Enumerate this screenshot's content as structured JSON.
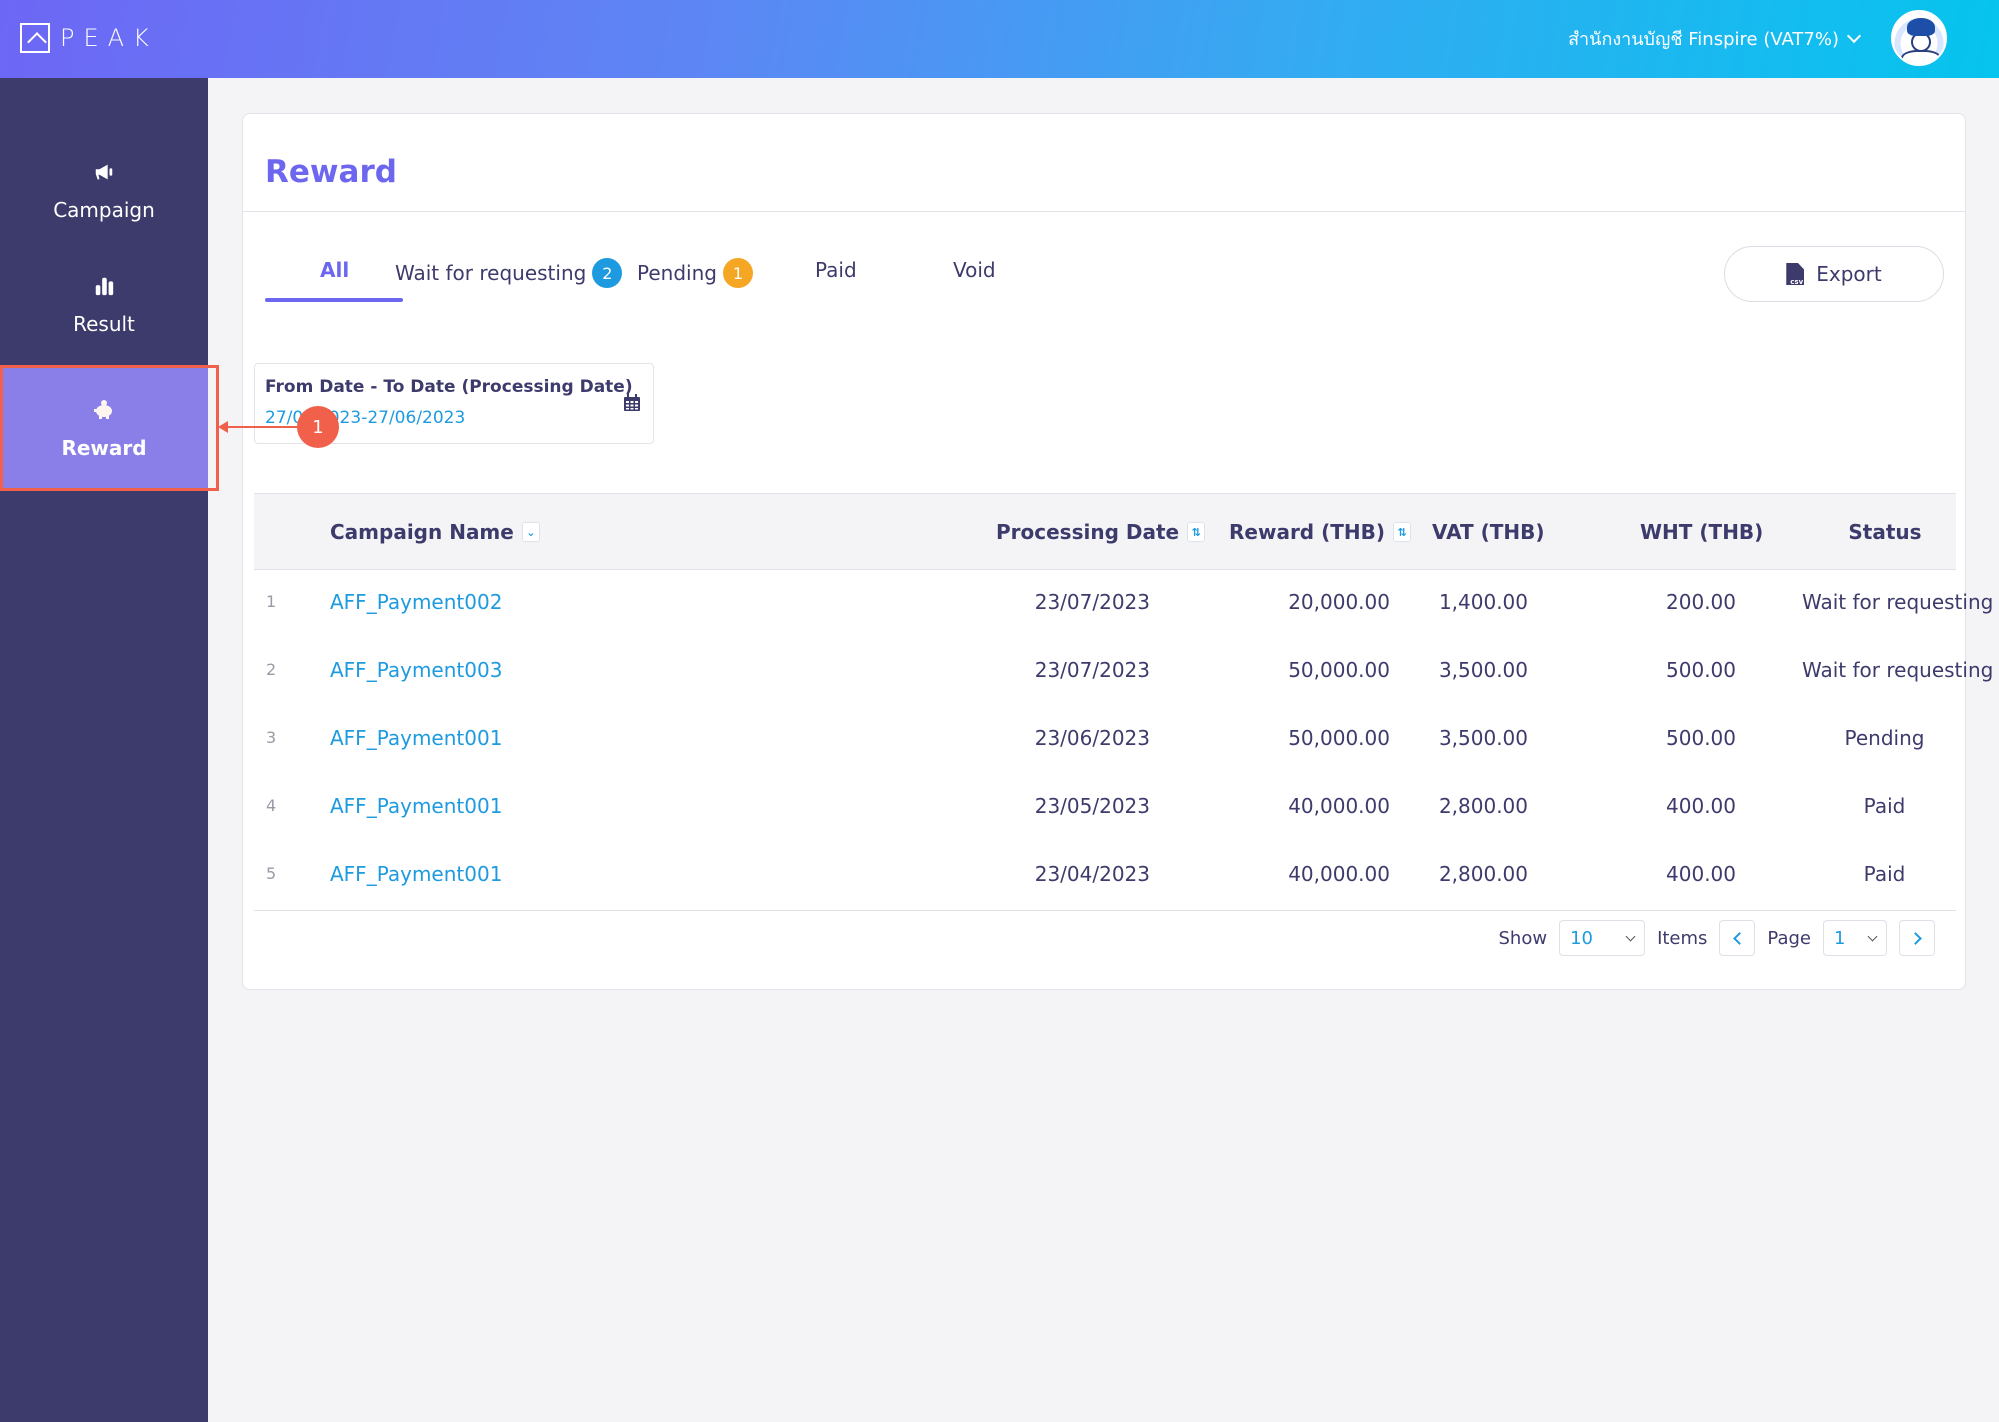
{
  "app": {
    "logo_text": "PEAK",
    "company_selector": "สำนักงานบัญชี Finspire (VAT7%)"
  },
  "sidebar": {
    "items": [
      {
        "label": "Campaign",
        "icon": "megaphone-icon",
        "active": false
      },
      {
        "label": "Result",
        "icon": "bar-chart-icon",
        "active": false
      },
      {
        "label": "Reward",
        "icon": "piggy-bank-icon",
        "active": true
      }
    ]
  },
  "annotation": {
    "badge": "1"
  },
  "page": {
    "title": "Reward",
    "tabs": [
      {
        "label": "All",
        "active": true
      },
      {
        "label": "Wait for requesting",
        "badge": "2",
        "badge_color": "#1e9be0"
      },
      {
        "label": "Pending",
        "badge": "1",
        "badge_color": "#f5a623"
      },
      {
        "label": "Paid"
      },
      {
        "label": "Void"
      }
    ],
    "export_label": "Export",
    "export_icon": "csv-file-icon",
    "date_filter": {
      "label": "From Date - To Date (Processing Date)",
      "value": "27/0?/2023-27/06/2023"
    }
  },
  "table": {
    "columns": [
      "Campaign Name",
      "Processing Date",
      "Reward (THB)",
      "VAT (THB)",
      "WHT (THB)",
      "Status"
    ],
    "rows": [
      {
        "no": "1",
        "campaign": "AFF_Payment002",
        "date": "23/07/2023",
        "reward": "20,000.00",
        "vat": "1,400.00",
        "wht": "200.00",
        "status": "Wait for requesting"
      },
      {
        "no": "2",
        "campaign": "AFF_Payment003",
        "date": "23/07/2023",
        "reward": "50,000.00",
        "vat": "3,500.00",
        "wht": "500.00",
        "status": "Wait for requesting"
      },
      {
        "no": "3",
        "campaign": "AFF_Payment001",
        "date": "23/06/2023",
        "reward": "50,000.00",
        "vat": "3,500.00",
        "wht": "500.00",
        "status": "Pending"
      },
      {
        "no": "4",
        "campaign": "AFF_Payment001",
        "date": "23/05/2023",
        "reward": "40,000.00",
        "vat": "2,800.00",
        "wht": "400.00",
        "status": "Paid"
      },
      {
        "no": "5",
        "campaign": "AFF_Payment001",
        "date": "23/04/2023",
        "reward": "40,000.00",
        "vat": "2,800.00",
        "wht": "400.00",
        "status": "Paid"
      }
    ]
  },
  "pagination": {
    "show_label": "Show",
    "page_size": "10",
    "items_label": "Items",
    "page_label": "Page",
    "page": "1"
  },
  "colors": {
    "accent": "#6d67f0",
    "sidebar_bg": "#3d3b6b",
    "sidebar_active": "#8a7fe8",
    "link": "#1e9be0",
    "annotation": "#f0604a"
  }
}
